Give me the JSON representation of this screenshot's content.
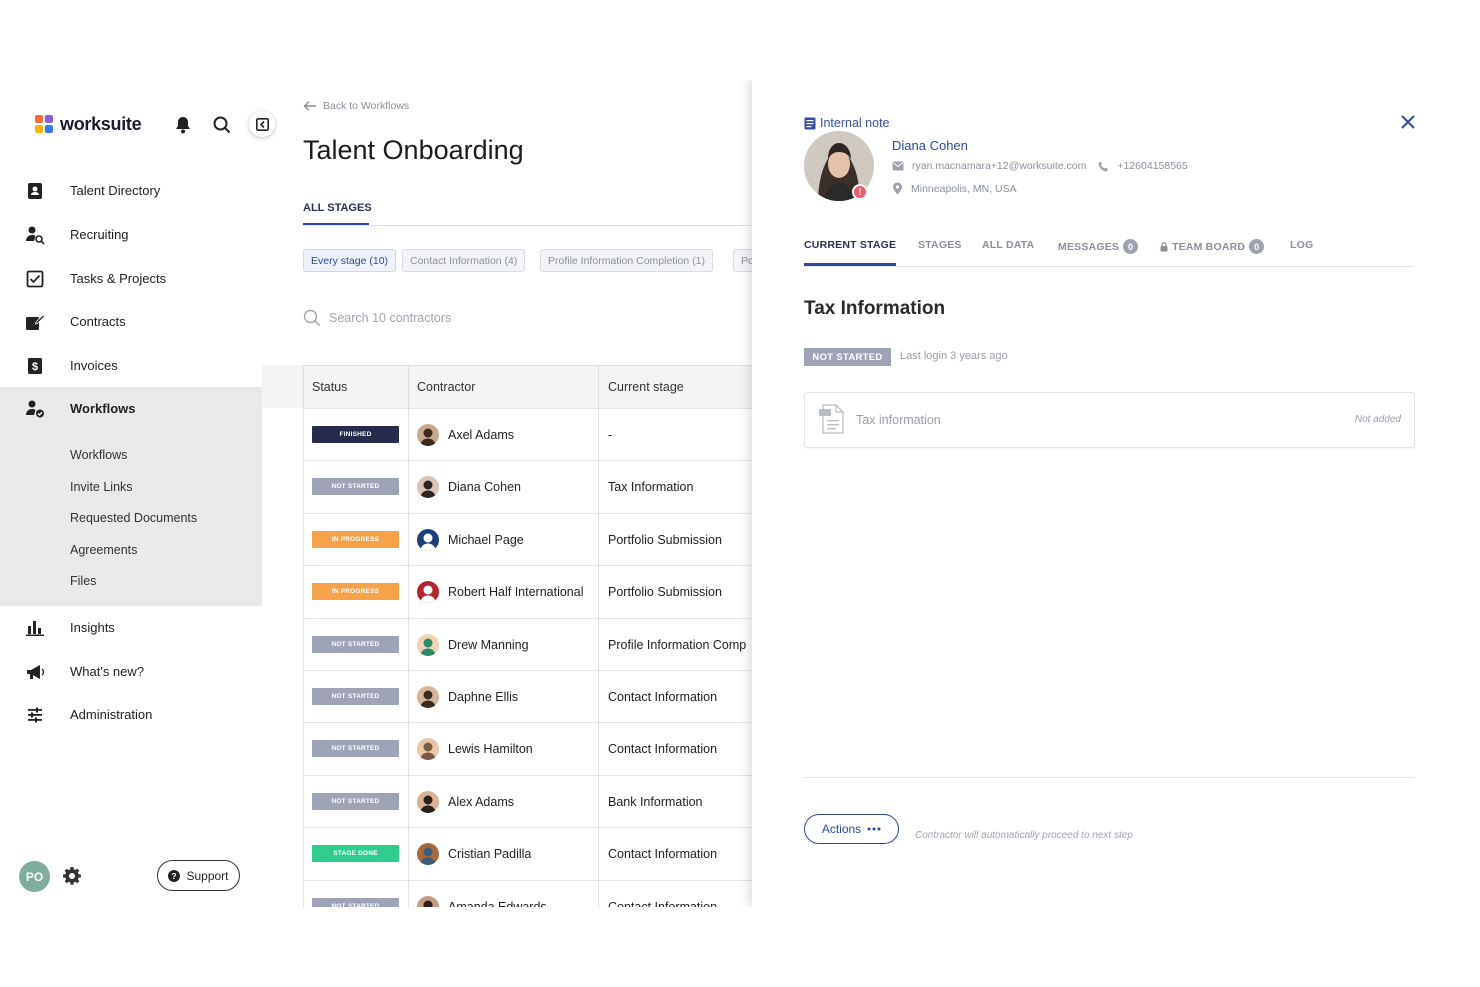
{
  "brand": {
    "name": "worksuite"
  },
  "sidebar": {
    "items": [
      {
        "label": "Talent Directory",
        "icon": "contacts-book-icon"
      },
      {
        "label": "Recruiting",
        "icon": "person-search-icon"
      },
      {
        "label": "Tasks & Projects",
        "icon": "checkbox-icon"
      },
      {
        "label": "Contracts",
        "icon": "contract-pen-icon"
      },
      {
        "label": "Invoices",
        "icon": "invoice-dollar-icon"
      },
      {
        "label": "Workflows",
        "icon": "person-check-icon",
        "active": true
      },
      {
        "label": "Insights",
        "icon": "bar-chart-icon"
      },
      {
        "label": "What's new?",
        "icon": "megaphone-icon"
      },
      {
        "label": "Administration",
        "icon": "sliders-icon"
      }
    ],
    "subitems": [
      "Workflows",
      "Invite Links",
      "Requested Documents",
      "Agreements",
      "Files"
    ],
    "user_initials": "PO",
    "support_label": "Support"
  },
  "main": {
    "back_label": "Back to Workflows",
    "title": "Talent Onboarding",
    "tab": "ALL STAGES",
    "chips": [
      {
        "label": "Every stage (10)",
        "active": true
      },
      {
        "label": "Contact Information (4)"
      },
      {
        "label": "Profile Information Completion (1)"
      },
      {
        "label": "Po"
      }
    ],
    "search_placeholder": "Search 10 contractors",
    "columns": [
      "Status",
      "Contractor",
      "Current stage"
    ],
    "rows": [
      {
        "status": "FINISHED",
        "name": "Axel Adams",
        "stage": "-"
      },
      {
        "status": "NOT STARTED",
        "name": "Diana Cohen",
        "stage": "Tax Information"
      },
      {
        "status": "IN PROGRESS",
        "name": "Michael Page",
        "stage": "Portfolio Submission"
      },
      {
        "status": "IN PROGRESS",
        "name": "Robert Half International",
        "stage": "Portfolio Submission"
      },
      {
        "status": "NOT STARTED",
        "name": "Drew Manning",
        "stage": "Profile Information Comp"
      },
      {
        "status": "NOT STARTED",
        "name": "Daphne Ellis",
        "stage": "Contact Information"
      },
      {
        "status": "NOT STARTED",
        "name": "Lewis Hamilton",
        "stage": "Contact Information"
      },
      {
        "status": "NOT STARTED",
        "name": "Alex Adams",
        "stage": "Bank Information"
      },
      {
        "status": "STAGE DONE",
        "name": "Cristian Padilla",
        "stage": "Contact Information"
      },
      {
        "status": "NOT STARTED",
        "name": "Amanda Edwards",
        "stage": "Contact Information"
      }
    ],
    "status_colors": {
      "FINISHED": "#262c4a",
      "NOT STARTED": "#9ea3b5",
      "IN PROGRESS": "#f5a24b",
      "STAGE DONE": "#2ecc8f"
    }
  },
  "drawer": {
    "internal_note": "Internal note",
    "contractor": {
      "name": "Diana Cohen",
      "email": "ryan.macnamara+12@worksuite.com",
      "phone": "+12604158565",
      "location": "Minneapolis, MN, USA"
    },
    "tabs": [
      {
        "label": "CURRENT STAGE",
        "active": true
      },
      {
        "label": "STAGES"
      },
      {
        "label": "ALL DATA"
      },
      {
        "label": "MESSAGES",
        "count": "0"
      },
      {
        "label": "TEAM BOARD",
        "count": "0",
        "locked": true
      },
      {
        "label": "LOG"
      }
    ],
    "section_title": "Tax Information",
    "status_badge": "NOT STARTED",
    "last_login": "Last login 3 years ago",
    "document": {
      "label": "Tax information",
      "status": "Not added"
    },
    "actions_label": "Actions",
    "actions_icon": "more-dots-icon",
    "auto_note": "Contractor will automatically proceed to next step"
  },
  "colors": {
    "accent": "#2f4a9e",
    "alert": "#ec5b66",
    "sidebar_active_bg": "#e9e9e9"
  }
}
